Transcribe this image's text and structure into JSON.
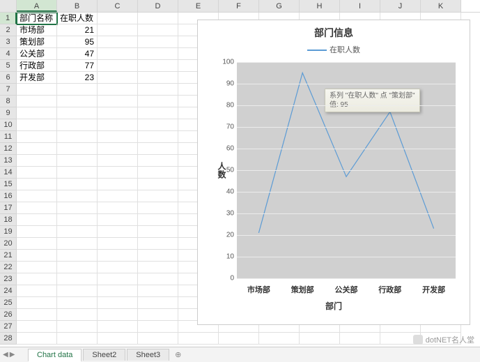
{
  "columns": [
    "A",
    "B",
    "C",
    "D",
    "E",
    "F",
    "G",
    "H",
    "I",
    "J",
    "K"
  ],
  "rows": 28,
  "selected_cell": "A1",
  "data": {
    "headers": [
      "部门名称",
      "在职人数"
    ],
    "records": [
      {
        "name": "市场部",
        "count": 21
      },
      {
        "name": "策划部",
        "count": 95
      },
      {
        "name": "公关部",
        "count": 47
      },
      {
        "name": "行政部",
        "count": 77
      },
      {
        "name": "开发部",
        "count": 23
      }
    ]
  },
  "chart_data": {
    "type": "line",
    "title": "部门信息",
    "series_name": "在职人数",
    "xlabel": "部门",
    "ylabel": "人数",
    "categories": [
      "市场部",
      "策划部",
      "公关部",
      "行政部",
      "开发部"
    ],
    "values": [
      21,
      95,
      47,
      77,
      23
    ],
    "ylim": [
      0,
      100
    ],
    "yticks": [
      0,
      10,
      20,
      30,
      40,
      50,
      60,
      70,
      80,
      90,
      100
    ]
  },
  "tooltip": {
    "line1": "系列 \"在职人数\" 点 \"策划部\"",
    "line2": "值: 95"
  },
  "tabs": {
    "items": [
      "Chart data",
      "Sheet2",
      "Sheet3"
    ],
    "active": 0
  },
  "brand": "dotNET名人堂"
}
